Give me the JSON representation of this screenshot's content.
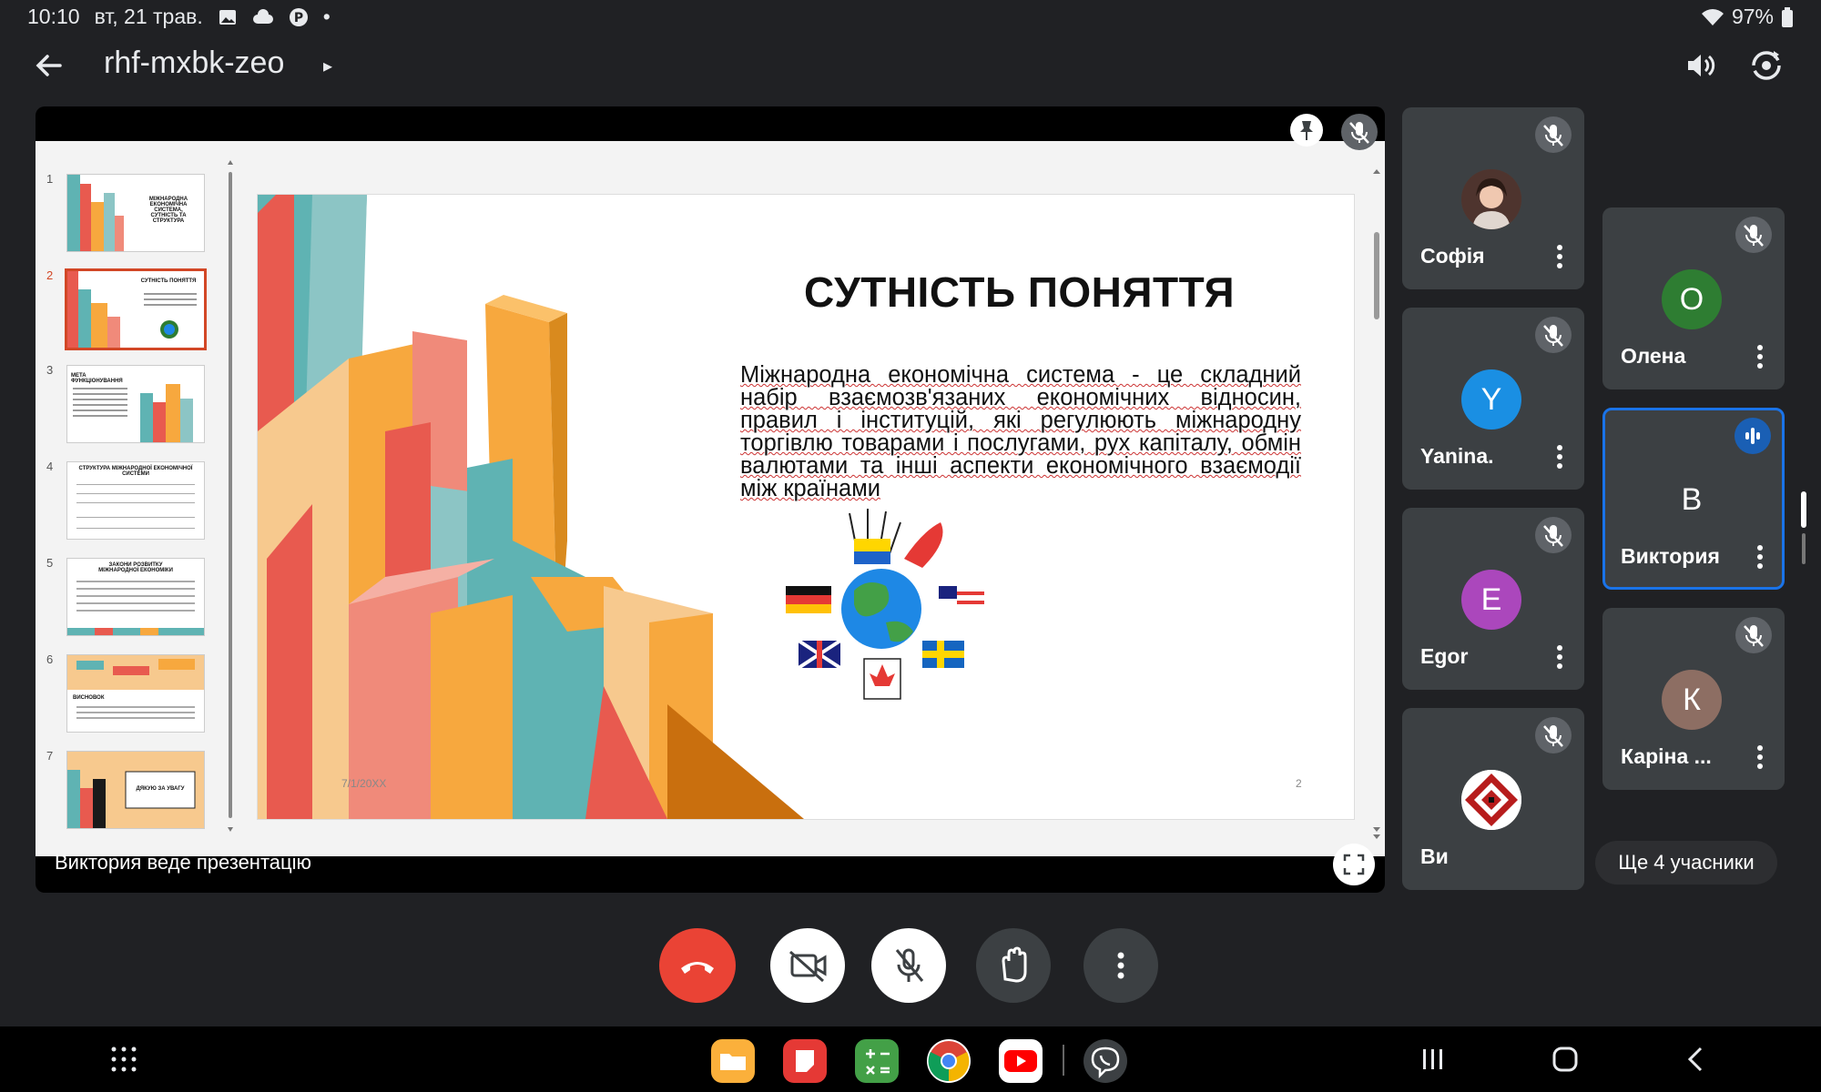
{
  "status_bar": {
    "time": "10:10",
    "date": "вт, 21 трав.",
    "dot": "•",
    "battery": "97%"
  },
  "meeting": {
    "code": "rhf-mxbk-zeo",
    "code_arrow": "▸"
  },
  "presentation": {
    "presenter_label": "Виктория веде презентацію",
    "slides": [
      {
        "num": "1",
        "title": "МІЖНАРОДНА ЕКОНОМІЧНА СИСТЕМА, СУТНІСТЬ ТА СТРУКТУРА"
      },
      {
        "num": "2",
        "title": "СУТНІСТЬ ПОНЯТТЯ"
      },
      {
        "num": "3",
        "title": "МЕТА ФУНКЦІОНУВАННЯ"
      },
      {
        "num": "4",
        "title": "СТРУКТУРА МІЖНАРОДНОЇ ЕКОНОМІЧНОЇ СИСТЕМИ"
      },
      {
        "num": "5",
        "title": "ЗАКОНИ РОЗВИТКУ МІЖНАРОДНОЇ ЕКОНОМІКИ"
      },
      {
        "num": "6",
        "title": "ВИСНОВОК"
      },
      {
        "num": "7",
        "title": "ДЯКУЮ ЗА УВАГУ"
      }
    ],
    "current_slide": {
      "title": "СУТНІСТЬ ПОНЯТТЯ",
      "body": "Міжнародна економічна система - це складний набір взаємозв'язаних економічних відносин, правил і інституцій, які регулюють міжнародну торгівлю товарами і послугами, рух капіталу, обмін валютами та інші аспекти економічного взаємодії між країнами",
      "date": "7/1/20XX",
      "page": "2"
    }
  },
  "participants": [
    {
      "name": "Софія",
      "avatar": "",
      "avatar_color": "#6d4c41",
      "muted": true
    },
    {
      "name": "Yanina.",
      "avatar": "Y",
      "avatar_color": "#1a8fe3",
      "muted": true
    },
    {
      "name": "Egor",
      "avatar": "E",
      "avatar_color": "#ab47bc",
      "muted": true
    },
    {
      "name": "Ви",
      "avatar": "",
      "avatar_color": "#b71c1c",
      "muted": true
    },
    {
      "name": "Олена",
      "avatar": "О",
      "avatar_color": "#2e7d32",
      "muted": true
    },
    {
      "name": "Виктория",
      "avatar": "В",
      "avatar_color": "#ab47bc",
      "speaking": true
    },
    {
      "name": "Каріна ...",
      "avatar": "К",
      "avatar_color": "#8d6e63",
      "muted": true
    }
  ],
  "more_participants": "Ще 4 учасники",
  "colors": {
    "background": "#202124",
    "tile": "#3c4043",
    "end_call": "#ea4335",
    "active_border": "#1a73e8",
    "slide_accent": "#d24726"
  },
  "icons": {
    "back": "arrow-left",
    "speaker": "volume",
    "camera_switch": "camera-flip",
    "pin": "pin",
    "mic_off": "mic-off",
    "fullscreen": "fullscreen",
    "end_call": "phone-hangup",
    "camera_off": "video-off",
    "raise_hand": "hand",
    "more": "more-vertical"
  }
}
